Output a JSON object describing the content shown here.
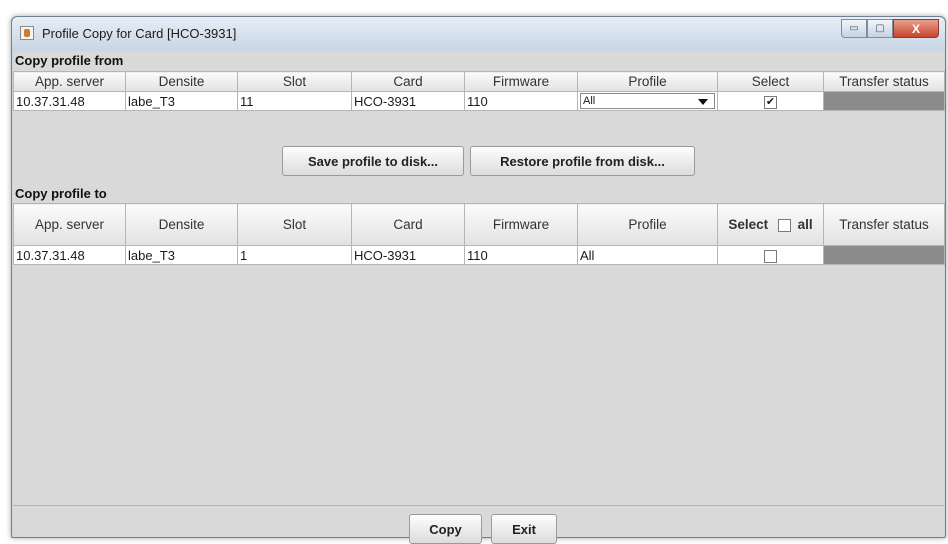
{
  "window": {
    "title": "Profile Copy for Card [HCO-3931]",
    "controls": {
      "minimize": "▭",
      "maximize": "▢",
      "close": "X"
    }
  },
  "from_section": {
    "label": "Copy profile from",
    "columns": [
      "App. server",
      "Densite",
      "Slot",
      "Card",
      "Firmware",
      "Profile",
      "Select",
      "Transfer status"
    ],
    "row": {
      "app_server": "10.37.31.48",
      "densite": "labe_T3",
      "slot": "11",
      "card": "HCO-3931",
      "firmware": "110",
      "profile": "All",
      "select_checked": true,
      "check_mark": "✔",
      "transfer_status": ""
    }
  },
  "disk_buttons": {
    "save": "Save profile to disk...",
    "restore": "Restore profile from disk..."
  },
  "to_section": {
    "label": "Copy profile to",
    "columns": [
      "App. server",
      "Densite",
      "Slot",
      "Card",
      "Firmware",
      "Profile",
      "Select",
      "all",
      "Transfer status"
    ],
    "row": {
      "app_server": "10.37.31.48",
      "densite": "labe_T3",
      "slot": "1",
      "card": "HCO-3931",
      "firmware": "110",
      "profile": "All",
      "select_checked": false,
      "transfer_status": ""
    }
  },
  "footer": {
    "copy": "Copy",
    "exit": "Exit"
  },
  "colors": {
    "status_fill": "#8c8c8c",
    "window_bg": "#d9d9d9"
  }
}
